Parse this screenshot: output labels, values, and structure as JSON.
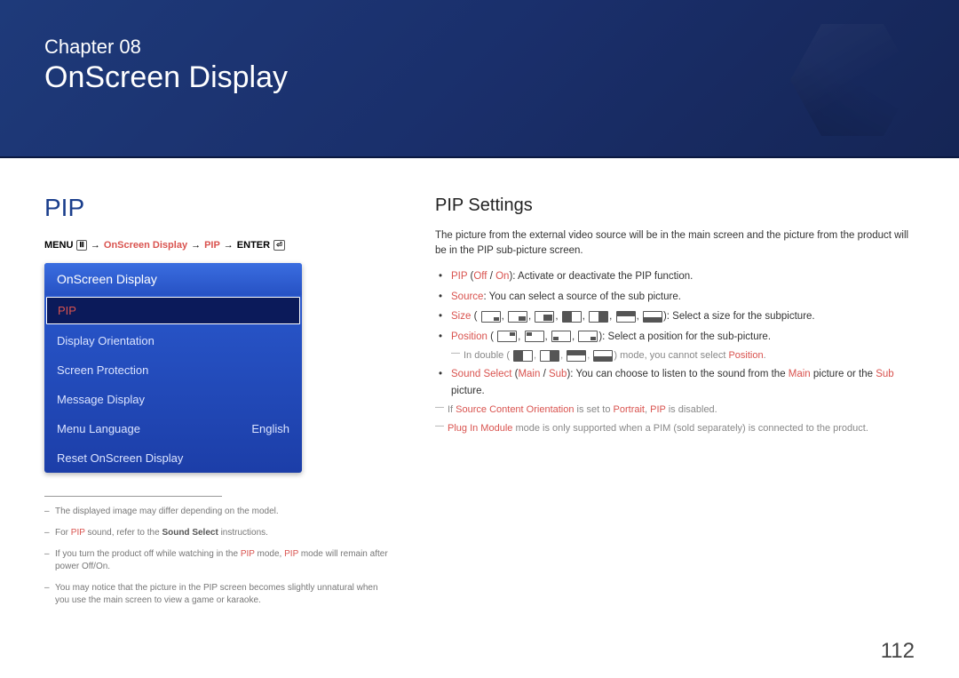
{
  "header": {
    "chapter_label": "Chapter  08",
    "chapter_title": "OnScreen Display"
  },
  "left": {
    "heading": "PIP",
    "breadcrumb": {
      "menu": "MENU",
      "path1": "OnScreen Display",
      "path2": "PIP",
      "enter": "ENTER"
    },
    "panel": {
      "title": "OnScreen Display",
      "items": [
        {
          "label": "PIP",
          "value": "",
          "selected": true
        },
        {
          "label": "Display Orientation",
          "value": "",
          "selected": false
        },
        {
          "label": "Screen Protection",
          "value": "",
          "selected": false
        },
        {
          "label": "Message Display",
          "value": "",
          "selected": false
        },
        {
          "label": "Menu Language",
          "value": "English",
          "selected": false
        },
        {
          "label": "Reset OnScreen Display",
          "value": "",
          "selected": false
        }
      ]
    },
    "footnotes": {
      "f1": "The displayed image may differ depending on the model.",
      "f2_pre": "For ",
      "f2_hl": "PIP",
      "f2_mid": " sound, refer to the ",
      "f2_bold": "Sound Select",
      "f2_post": " instructions.",
      "f3_pre": "If you turn the product off while watching in the ",
      "f3_hl1": "PIP",
      "f3_mid": " mode, ",
      "f3_hl2": "PIP",
      "f3_post": " mode will remain after power Off/On.",
      "f4": "You may notice that the picture in the PIP screen becomes slightly unnatural when you use the main screen to view a game or karaoke."
    }
  },
  "right": {
    "heading": "PIP Settings",
    "intro": "The picture from the external video source will be in the main screen and the picture from the product will be in the PIP sub-picture screen.",
    "b1_hl": "PIP",
    "b1_paren": " (",
    "b1_off": "Off",
    "b1_slash": " / ",
    "b1_on": "On",
    "b1_post": "): Activate or deactivate the PIP function.",
    "b2_hl": "Source",
    "b2_post": ": You can select a source of the sub picture.",
    "b3_hl": "Size",
    "b3_paren_open": " (",
    "b3_post": "): Select a size for the subpicture.",
    "b4_hl": "Position",
    "b4_paren_open": " (",
    "b4_post": "): Select a position for the sub-picture.",
    "sub1_pre": "In double (",
    "sub1_post": ") mode, you cannot select ",
    "sub1_hl": "Position",
    "sub1_end": ".",
    "b5_hl": "Sound Select",
    "b5_paren": " (",
    "b5_main": "Main",
    "b5_slash": " / ",
    "b5_sub": "Sub",
    "b5_mid": "): You can choose to listen to the sound from the ",
    "b5_main2": "Main",
    "b5_mid2": " picture or the ",
    "b5_sub2": "Sub",
    "b5_post": " picture.",
    "sub2_pre": "If ",
    "sub2_hl1": "Source Content Orientation",
    "sub2_mid": " is set to ",
    "sub2_hl2": "Portrait",
    "sub2_mid2": ", ",
    "sub2_hl3": "PIP",
    "sub2_post": " is disabled.",
    "sub3_hl": "Plug In Module",
    "sub3_post": " mode is only supported when a PIM (sold separately) is connected to the product."
  },
  "page_number": "112"
}
